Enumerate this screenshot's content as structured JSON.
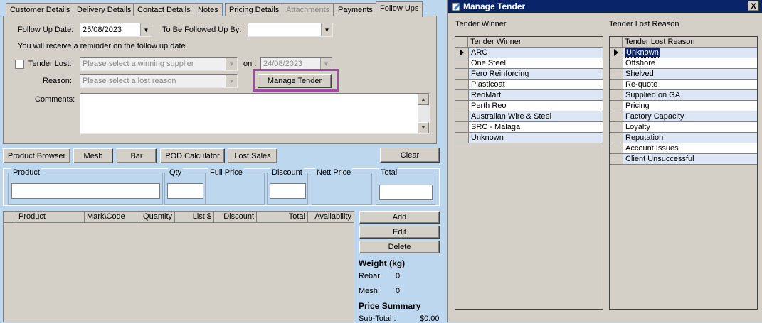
{
  "tabs": [
    "Customer Details",
    "Delivery Details",
    "Contact Details",
    "Notes",
    "Pricing Details",
    "Attachments",
    "Payments",
    "Follow Ups"
  ],
  "followups": {
    "follow_up_date_label": "Follow Up Date:",
    "follow_up_date_value": "25/08/2023",
    "followed_up_by_label": "To Be Followed Up By:",
    "followed_up_by_value": "",
    "reminder_text": "You will receive a reminder on the follow up date",
    "tender_lost_label": "Tender Lost:",
    "winner_placeholder": "Please select a winning supplier",
    "on_label": "on :",
    "on_date_value": "24/08/2023",
    "reason_label": "Reason:",
    "reason_placeholder": "Please select a lost reason",
    "manage_tender_label": "Manage Tender",
    "comments_label": "Comments:"
  },
  "toolbar": {
    "product_browser": "Product Browser",
    "mesh": "Mesh",
    "bar": "Bar",
    "pod_calculator": "POD Calculator",
    "lost_sales": "Lost Sales",
    "clear": "Clear"
  },
  "entry": {
    "product": "Product",
    "qty": "Qty",
    "full_price": "Full Price",
    "discount": "Discount",
    "nett_price": "Nett Price",
    "total": "Total"
  },
  "grid": {
    "columns": [
      "Product",
      "Mark\\Code",
      "Quantity",
      "List $",
      "Discount",
      "Total",
      "Availability"
    ]
  },
  "side": {
    "add": "Add",
    "edit": "Edit",
    "delete": "Delete",
    "weight_title": "Weight (kg)",
    "rebar_label": "Rebar:",
    "rebar_value": "0",
    "mesh_label": "Mesh:",
    "mesh_value": "0",
    "price_summary_title": "Price Summary",
    "subtotal_label": "Sub-Total :",
    "subtotal_value": "$0.00"
  },
  "dialog": {
    "title": "Manage Tender",
    "close": "X",
    "winner_section": "Tender Winner",
    "winner_header": "Tender Winner",
    "winners": [
      "ARC",
      "One Steel",
      "Fero Reinforcing",
      "Plasticoat",
      "ReoMart",
      "Perth Reo",
      "Australian Wire & Steel",
      "SRC - Malaga",
      "Unknown"
    ],
    "reason_section": "Tender Lost Reason",
    "reason_header": "Tender Lost Reason",
    "reasons": [
      "Unknown",
      "Offshore",
      "Shelved",
      "Re-quote",
      "Supplied on GA",
      "Pricing",
      "Factory Capacity",
      "Loyalty",
      "Reputation",
      "Account Issues",
      "Client Unsuccessful"
    ]
  },
  "colors": {
    "form_background": "#bdd7ee",
    "dialog_title": "#0a246a",
    "highlight": "#a347ad"
  }
}
